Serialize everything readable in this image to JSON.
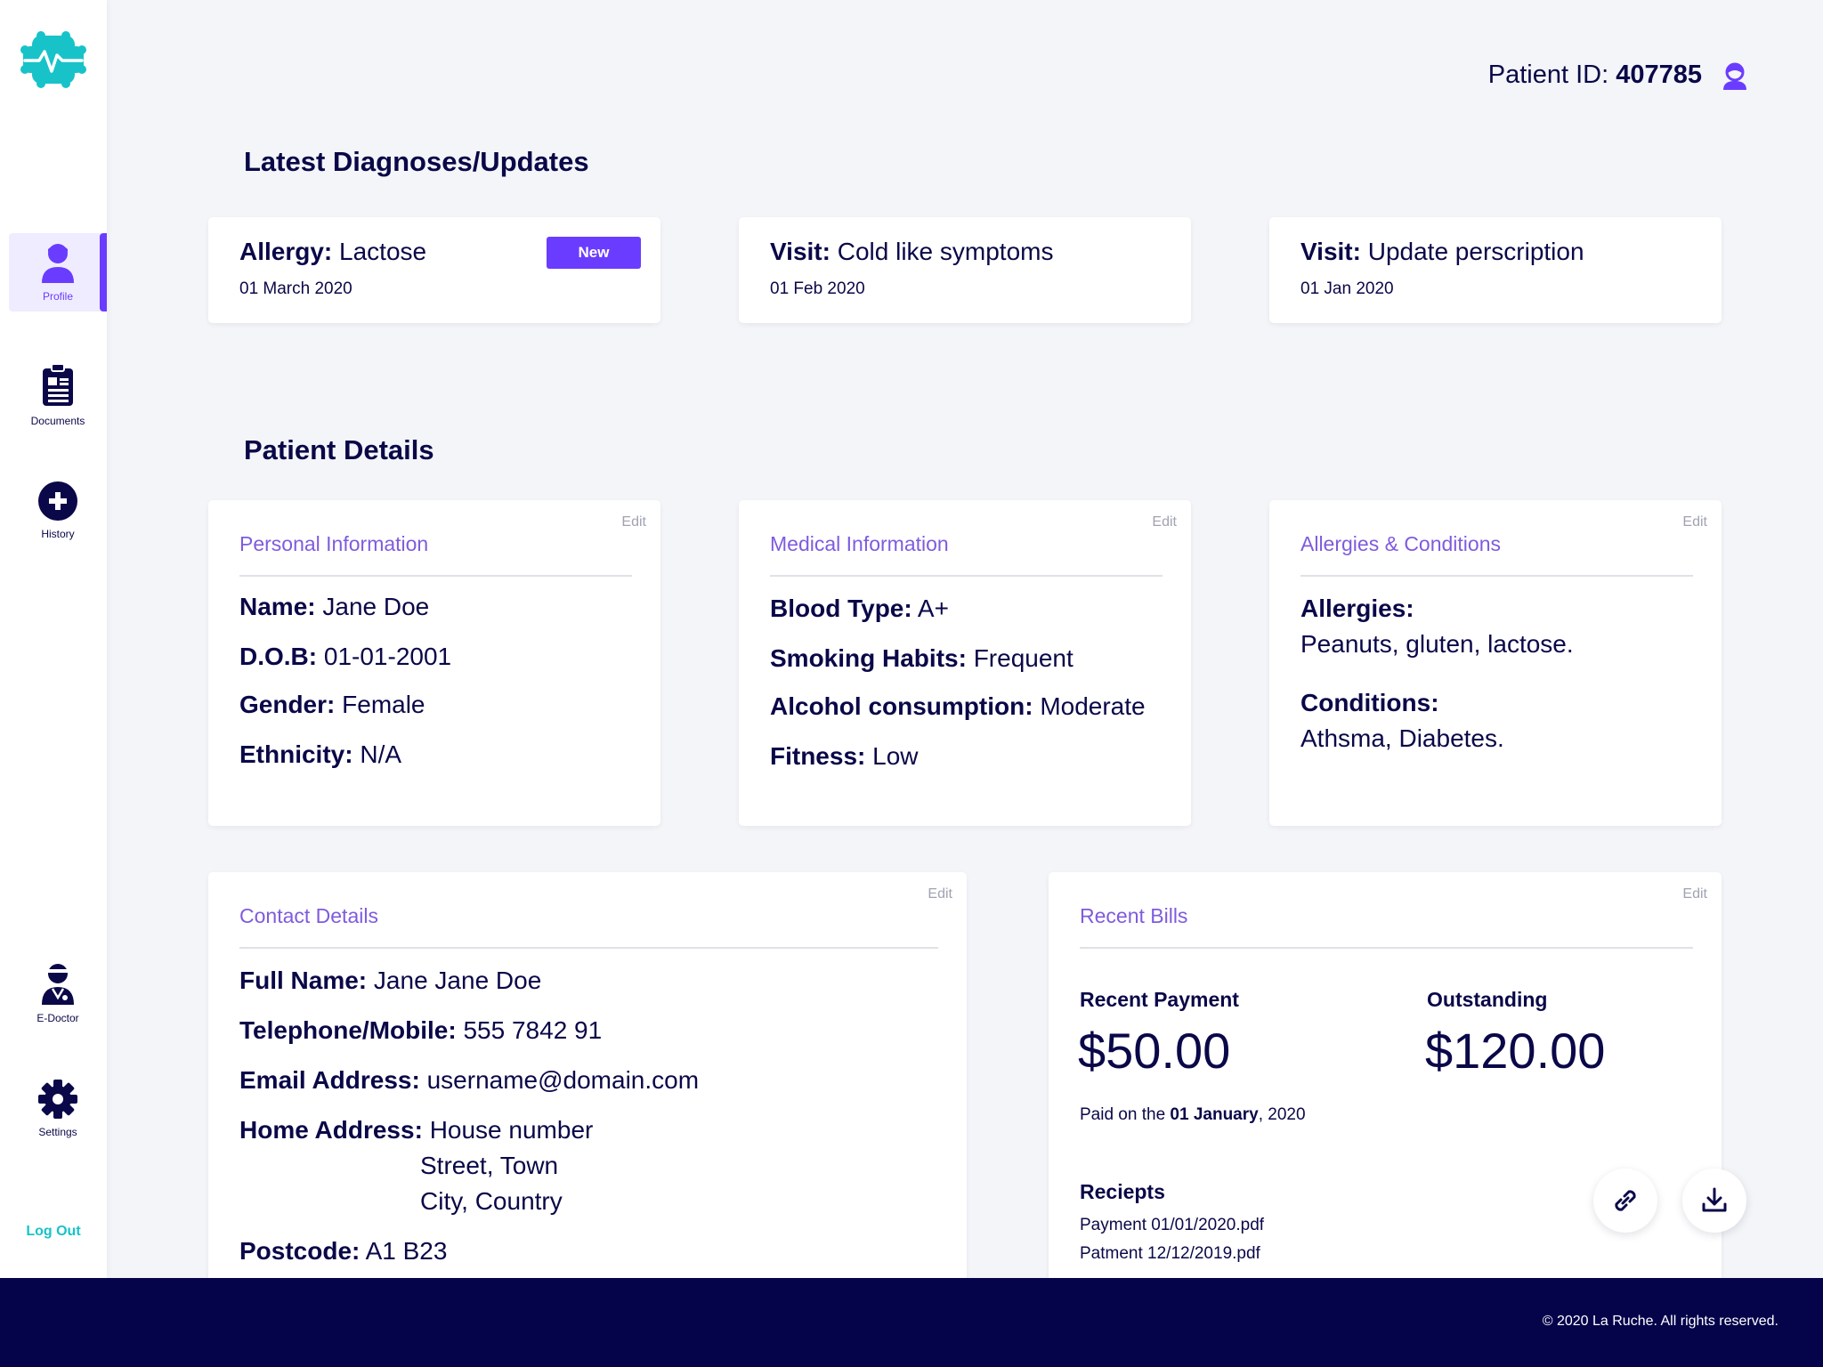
{
  "brand": {
    "logo_icon": "heartbeat-cog-logo",
    "accent": "#6a3cff",
    "brand_teal": "#17c3c9",
    "navy": "#05034a"
  },
  "header": {
    "patient_id_label": "Patient ID:",
    "patient_id_value": "407785",
    "user_icon": "patient-avatar-icon"
  },
  "sidebar": {
    "items": [
      {
        "label": "Profile",
        "icon": "user-icon",
        "active": true
      },
      {
        "label": "Documents",
        "icon": "clipboard-icon",
        "active": false
      },
      {
        "label": "History",
        "icon": "plus-circle-icon",
        "active": false
      },
      {
        "label": "E-Doctor",
        "icon": "doctor-icon",
        "active": false
      },
      {
        "label": "Settings",
        "icon": "gear-icon",
        "active": false
      }
    ],
    "logout": "Log Out"
  },
  "diagnoses": {
    "title": "Latest Diagnoses/Updates",
    "items": [
      {
        "type": "Allergy:",
        "text": "Lactose",
        "date": "01 March 2020",
        "badge": "New"
      },
      {
        "type": "Visit:",
        "text": "Cold like symptoms",
        "date": "01 Feb 2020"
      },
      {
        "type": "Visit:",
        "text": "Update perscription",
        "date": "01 Jan 2020"
      }
    ]
  },
  "details": {
    "title": "Patient Details",
    "edit": "Edit",
    "personal": {
      "heading": "Personal Information",
      "fields": [
        {
          "label": "Name:",
          "value": "Jane Doe"
        },
        {
          "label": "D.O.B:",
          "value": "01-01-2001"
        },
        {
          "label": "Gender:",
          "value": "Female"
        },
        {
          "label": "Ethnicity:",
          "value": "N/A"
        }
      ]
    },
    "medical": {
      "heading": "Medical Information",
      "fields": [
        {
          "label": "Blood Type:",
          "value": "A+"
        },
        {
          "label": "Smoking Habits:",
          "value": "Frequent"
        },
        {
          "label": "Alcohol consumption:",
          "value": "Moderate"
        },
        {
          "label": "Fitness:",
          "value": "Low"
        }
      ]
    },
    "allergies": {
      "heading": "Allergies & Conditions",
      "allergies_label": "Allergies:",
      "allergies_value": "Peanuts, gluten, lactose.",
      "conditions_label": "Conditions:",
      "conditions_value": "Athsma, Diabetes."
    },
    "contact": {
      "heading": "Contact Details",
      "full_name_label": "Full Name:",
      "full_name": "Jane Jane Doe",
      "phone_label": "Telephone/Mobile:",
      "phone": "555 7842 91",
      "email_label": "Email Address:",
      "email": "username@domain.com",
      "address_label": "Home Address:",
      "address_line1": "House number",
      "address_line2": "Street, Town",
      "address_line3": "City, Country",
      "postcode_label": "Postcode:",
      "postcode": "A1 B23"
    },
    "bills": {
      "heading": "Recent Bills",
      "recent_label": "Recent Payment",
      "recent_amount": "$50.00",
      "outstanding_label": "Outstanding",
      "outstanding_amount": "$120.00",
      "paid_prefix": "Paid on the",
      "paid_date": "01 January",
      "paid_year": ", 2020",
      "receipts_label": "Reciepts",
      "receipts": [
        "Payment 01/01/2020.pdf",
        "Patment 12/12/2019.pdf"
      ],
      "link_icon": "link-icon",
      "download_icon": "download-icon"
    }
  },
  "footer": {
    "copyright": "© 2020 La Ruche. All rights reserved."
  }
}
